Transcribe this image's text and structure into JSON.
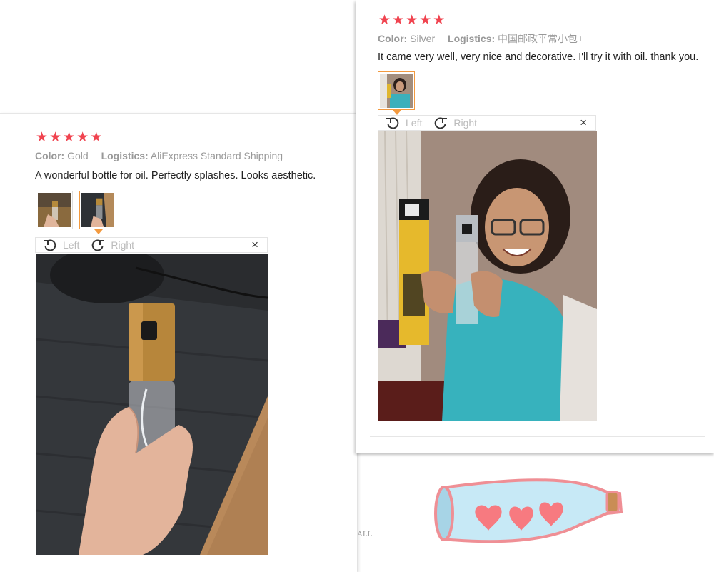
{
  "review_left": {
    "stars": [
      "★",
      "★",
      "★",
      "★",
      "★"
    ],
    "color_label": "Color:",
    "color_value": "Gold",
    "logistics_label": "Logistics:",
    "logistics_value": "AliExpress Standard Shipping",
    "text": "A wonderful bottle for oil. Perfectly splashes. Looks aesthetic.",
    "viewer": {
      "left_label": "Left",
      "right_label": "Right",
      "close": "×"
    }
  },
  "review_right": {
    "stars": [
      "★",
      "★",
      "★",
      "★",
      "★"
    ],
    "color_label": "Color:",
    "color_value": "Silver",
    "logistics_label": "Logistics:",
    "logistics_value": "中国邮政平常小包+",
    "text": "It came very well, very nice and decorative. I'll try it with oil. thank you.",
    "viewer": {
      "left_label": "Left",
      "right_label": "Right",
      "close": "×"
    }
  },
  "background": {
    "partial_text": "ALL"
  },
  "colors": {
    "star": "#f0434f",
    "accent": "#f39a3f"
  }
}
